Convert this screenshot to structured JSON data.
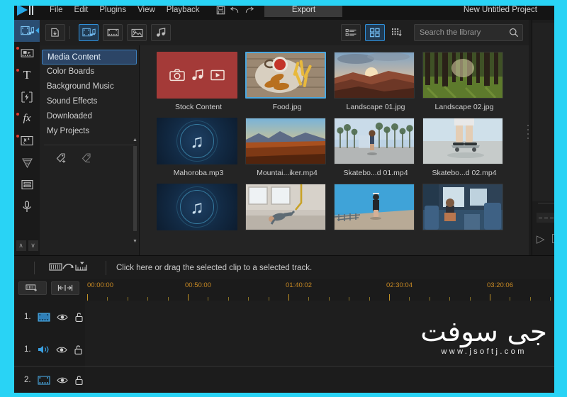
{
  "app": {
    "project_title": "New Untitled Project",
    "accent_cyan": "#29d3f5",
    "accent_blue": "#3a9fe0",
    "stock_red": "#a43a38"
  },
  "menubar": {
    "items": [
      "File",
      "Edit",
      "Plugins",
      "View",
      "Playback"
    ],
    "export_label": "Export",
    "icons": [
      "save-icon",
      "undo-icon",
      "redo-icon"
    ]
  },
  "rail": {
    "items": [
      {
        "name": "media-library",
        "selected": true,
        "badge": false
      },
      {
        "name": "transitions",
        "selected": false,
        "badge": true
      },
      {
        "name": "titles",
        "selected": false,
        "badge": true
      },
      {
        "name": "overlays",
        "selected": false,
        "badge": false
      },
      {
        "name": "effects",
        "selected": false,
        "badge": true
      },
      {
        "name": "masks",
        "selected": false,
        "badge": true
      },
      {
        "name": "particles",
        "selected": false,
        "badge": false
      },
      {
        "name": "split-screen",
        "selected": false,
        "badge": false
      },
      {
        "name": "voice-over",
        "selected": false,
        "badge": false
      }
    ],
    "scroll_up": "∧",
    "scroll_down": "∨"
  },
  "library_toolbar": {
    "import_label": "import-icon",
    "filters": [
      {
        "name": "all-media",
        "active": true
      },
      {
        "name": "video",
        "active": false
      },
      {
        "name": "photo",
        "active": false
      },
      {
        "name": "audio",
        "active": false
      }
    ],
    "views": [
      {
        "name": "list-view",
        "active": false
      },
      {
        "name": "grid-view",
        "active": true
      }
    ],
    "sort_name": "sort-icon"
  },
  "search": {
    "placeholder": "Search the library",
    "value": "",
    "icon": "search-icon"
  },
  "categories": {
    "items": [
      {
        "label": "Media Content",
        "selected": true
      },
      {
        "label": "Color Boards",
        "selected": false
      },
      {
        "label": "Background Music",
        "selected": false
      },
      {
        "label": "Sound Effects",
        "selected": false
      },
      {
        "label": "Downloaded",
        "selected": false
      },
      {
        "label": "My Projects",
        "selected": false
      }
    ],
    "tag_icons": [
      "add-tag-icon",
      "remove-tag-icon"
    ],
    "collapse_icon": "‹"
  },
  "media": {
    "items": [
      {
        "label": "Stock Content",
        "kind": "stock",
        "selected": false
      },
      {
        "label": "Food.jpg",
        "kind": "image-food",
        "selected": true
      },
      {
        "label": "Landscape 01.jpg",
        "kind": "image-canyon",
        "selected": false
      },
      {
        "label": "Landscape 02.jpg",
        "kind": "image-forest",
        "selected": false
      },
      {
        "label": "Mahoroba.mp3",
        "kind": "audio",
        "selected": false
      },
      {
        "label": "Mountai...iker.mp4",
        "kind": "image-mountain",
        "selected": false
      },
      {
        "label": "Skatebo...d 01.mp4",
        "kind": "image-palms",
        "selected": false
      },
      {
        "label": "Skatebo...d 02.mp4",
        "kind": "image-board",
        "selected": false
      },
      {
        "label": "",
        "kind": "audio",
        "selected": false
      },
      {
        "label": "",
        "kind": "image-gym",
        "selected": false
      },
      {
        "label": "",
        "kind": "image-pier",
        "selected": false
      },
      {
        "label": "",
        "kind": "image-train",
        "selected": false
      }
    ]
  },
  "hint_bar": {
    "text": "Click here or drag the selected clip to a selected track.",
    "icon": "place-clip-icon"
  },
  "timeline": {
    "tools": [
      "add-marker-icon",
      "fit-timeline-icon"
    ],
    "ruler_labels": [
      "00:00:00",
      "00:50:00",
      "01:40:02",
      "02:30:04",
      "03:20:06"
    ],
    "tracks": [
      {
        "number": "1.",
        "type": "video",
        "icon": "video-track-icon",
        "eye": "eye-icon",
        "lock": "unlock-icon"
      },
      {
        "number": "1.",
        "type": "audio",
        "icon": "audio-track-icon",
        "eye": "eye-icon",
        "lock": "unlock-icon"
      },
      {
        "number": "2.",
        "type": "video",
        "icon": "video-track-icon",
        "eye": "eye-icon",
        "lock": "unlock-icon"
      }
    ]
  },
  "watermark": {
    "arabic": "جی سوفت",
    "url": "www.jsoftj.com"
  }
}
